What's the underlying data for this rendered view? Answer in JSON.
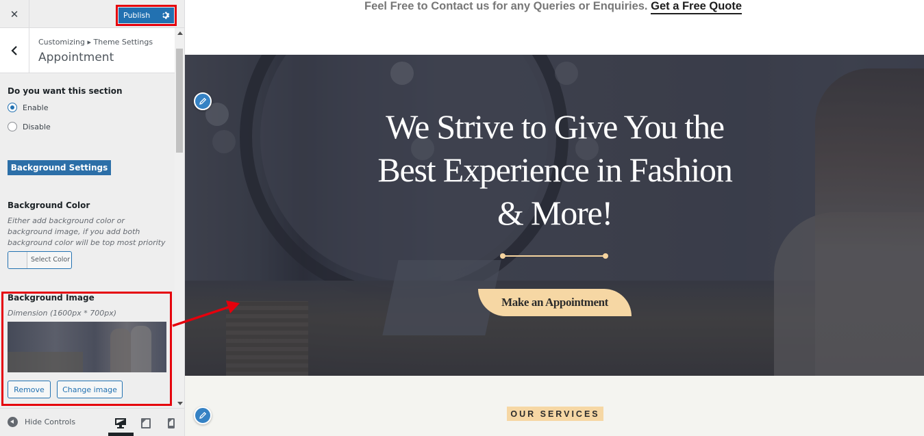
{
  "topbar": {
    "close_icon": "close-icon",
    "publish_label": "Publish",
    "publish_settings_icon": "gear-icon"
  },
  "panel": {
    "breadcrumb": "Customizing ▸ Theme Settings",
    "title": "Appointment",
    "back_icon": "chevron-left-icon"
  },
  "section_toggle": {
    "label": "Do you want this section",
    "options": [
      {
        "label": "Enable",
        "checked": true
      },
      {
        "label": "Disable",
        "checked": false
      }
    ]
  },
  "background_settings_label": "Background Settings",
  "background_color": {
    "label": "Background Color",
    "description": "Either add background color or background image, if you add both background color will be top most priority",
    "select_label": "Select Color"
  },
  "background_image": {
    "label": "Background Image",
    "dimension": "Dimension (1600px * 700px)",
    "remove_label": "Remove",
    "change_label": "Change image"
  },
  "footer": {
    "hide_controls": "Hide Controls",
    "devices": [
      "desktop",
      "tablet",
      "mobile"
    ],
    "active_device": "desktop"
  },
  "preview": {
    "contact_text": "Feel Free to Contact us for any Queries or Enquiries.",
    "quote_link": "Get a Free Quote",
    "hero_lines": [
      "We Strive to Give You the",
      "Best Experience in Fashion",
      "& More!"
    ],
    "cta_label": "Make an Appointment",
    "services_badge": "OUR SERVICES"
  },
  "colors": {
    "accent_blue": "#2271b1",
    "highlight_red": "#e5000c",
    "cream": "#f6d7a4",
    "services_bg": "#f4f4f0"
  }
}
